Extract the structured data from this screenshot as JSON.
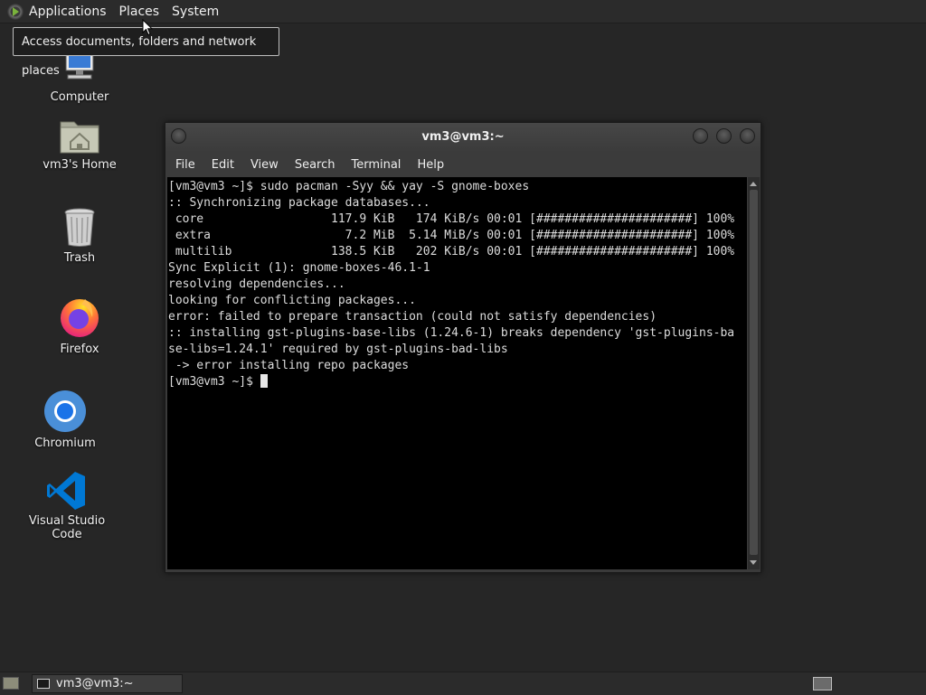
{
  "top_panel": {
    "applications": "Applications",
    "places": "Places",
    "system": "System"
  },
  "tooltip": "Access documents, folders and network places",
  "desktop_icons": [
    {
      "label": "Computer",
      "icon": "computer-icon"
    },
    {
      "label": "vm3's Home",
      "icon": "home-folder-icon"
    },
    {
      "label": "Trash",
      "icon": "trash-icon"
    },
    {
      "label": "Firefox",
      "icon": "firefox-icon"
    },
    {
      "label": "Chromium",
      "icon": "chromium-icon"
    },
    {
      "label": "Visual Studio Code",
      "icon": "vscode-icon"
    }
  ],
  "terminal": {
    "title": "vm3@vm3:~",
    "menu": [
      "File",
      "Edit",
      "View",
      "Search",
      "Terminal",
      "Help"
    ],
    "output": "[vm3@vm3 ~]$ sudo pacman -Syy && yay -S gnome-boxes\n:: Synchronizing package databases...\n core                  117.9 KiB   174 KiB/s 00:01 [######################] 100%\n extra                   7.2 MiB  5.14 MiB/s 00:01 [######################] 100%\n multilib              138.5 KiB   202 KiB/s 00:01 [######################] 100%\nSync Explicit (1): gnome-boxes-46.1-1\nresolving dependencies...\nlooking for conflicting packages...\nerror: failed to prepare transaction (could not satisfy dependencies)\n:: installing gst-plugins-base-libs (1.24.6-1) breaks dependency 'gst-plugins-ba\nse-libs=1.24.1' required by gst-plugins-bad-libs\n -> error installing repo packages\n",
    "prompt": "[vm3@vm3 ~]$ "
  },
  "taskbar": {
    "window_label": "vm3@vm3:~"
  },
  "colors": {
    "desktop": "#262626",
    "panel": "#2b2b2b",
    "terminal_bg": "#000000",
    "terminal_fg": "#dcdcdc"
  }
}
